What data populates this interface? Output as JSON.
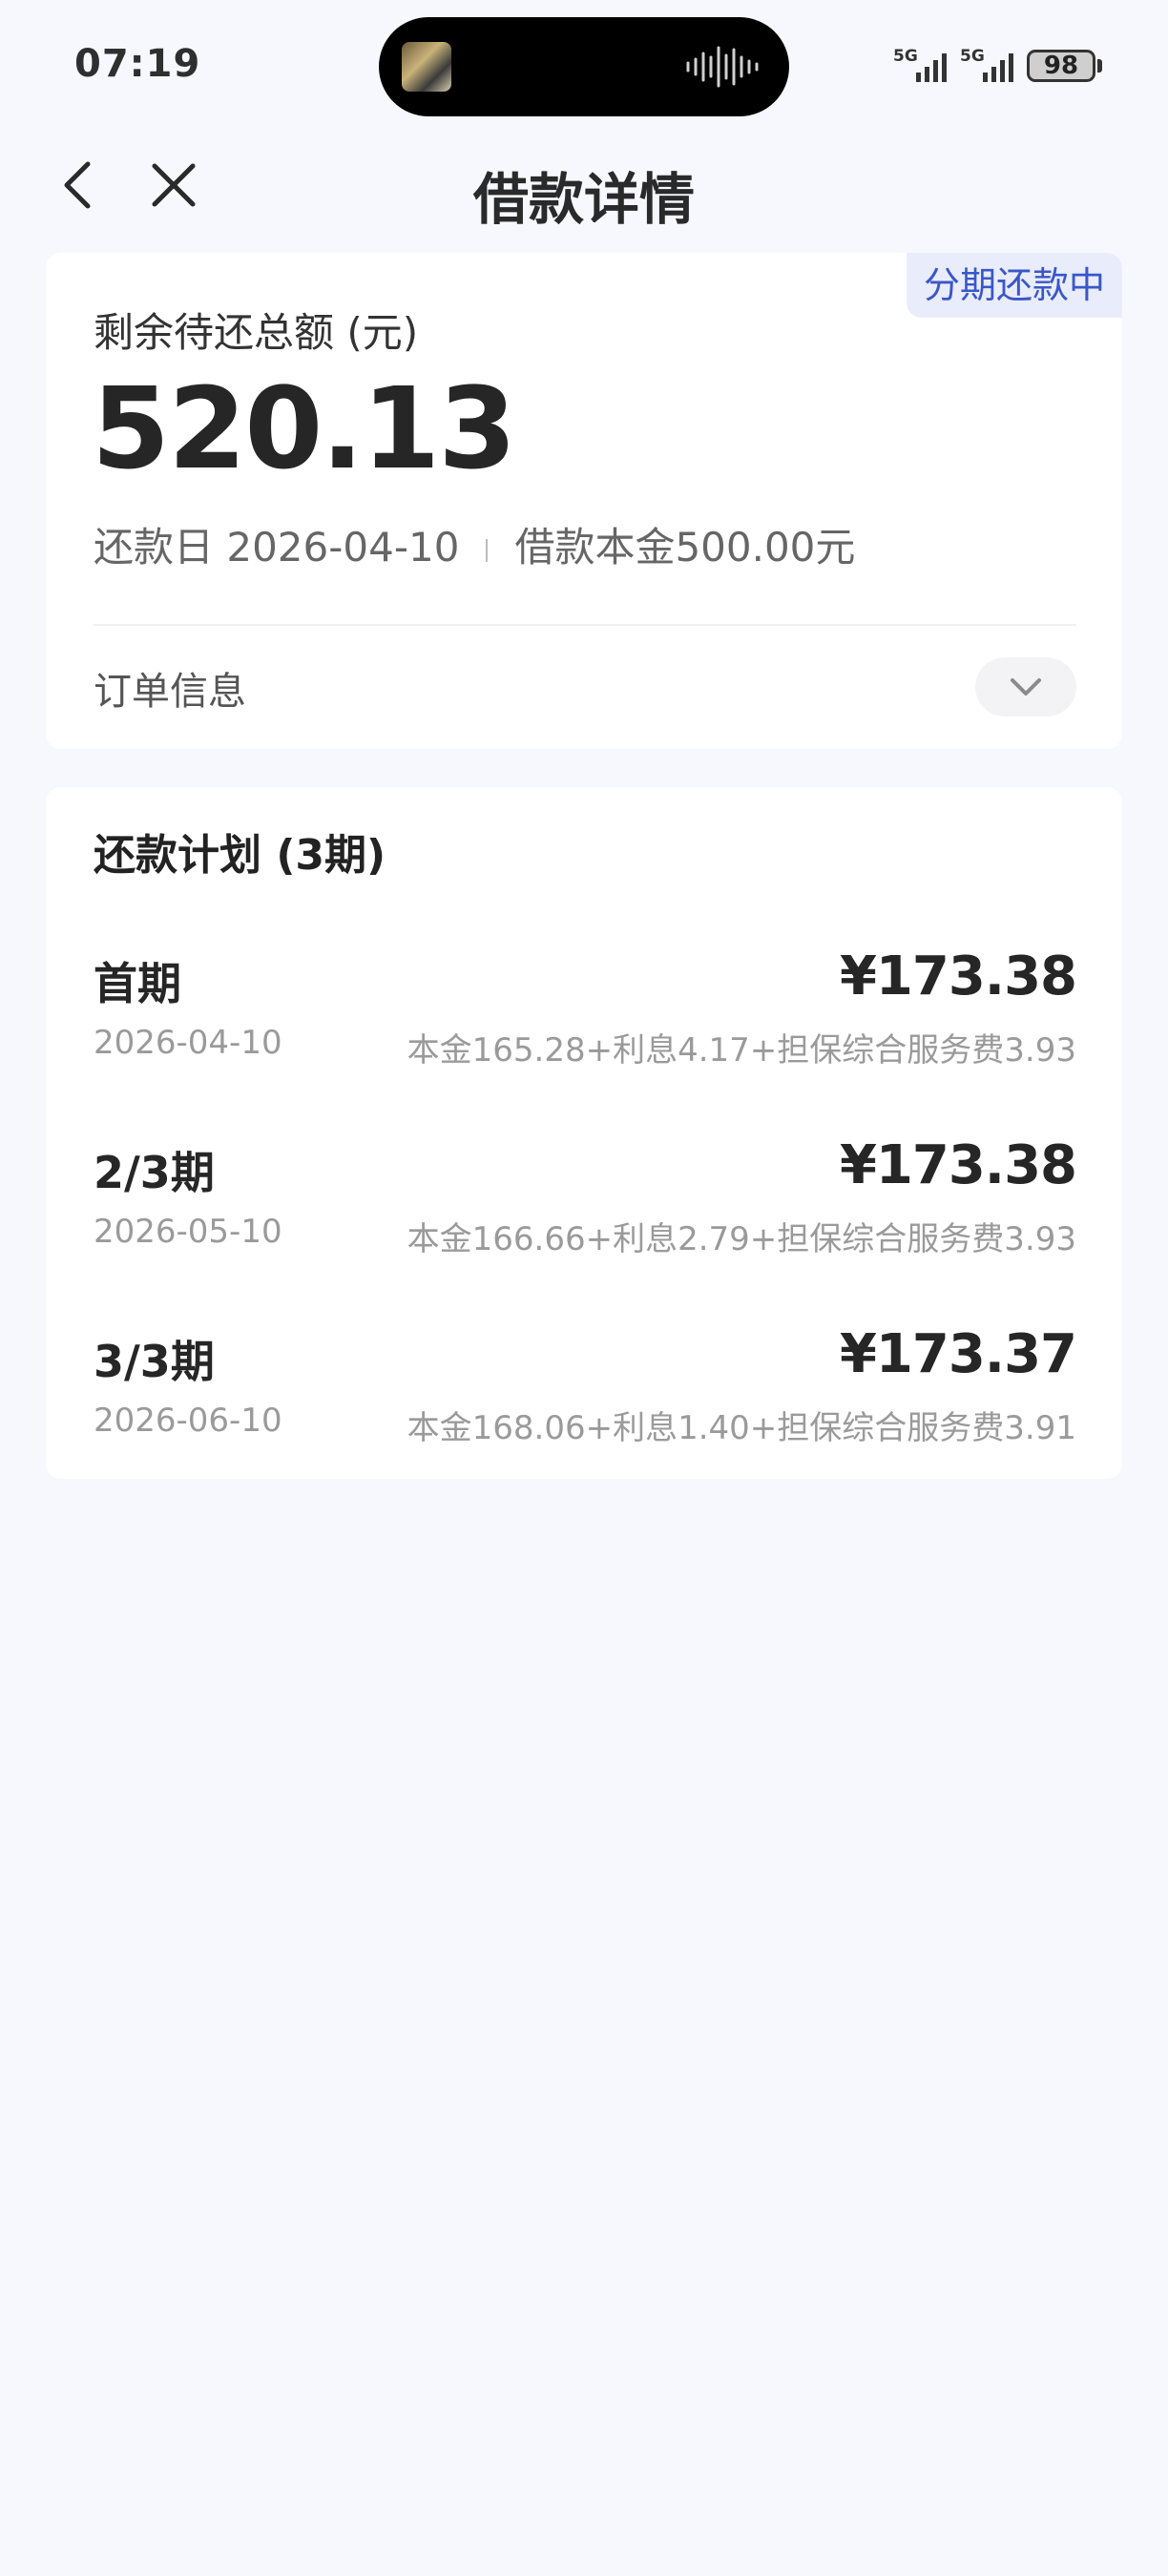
{
  "status_bar": {
    "time": "07:19",
    "network_1": "5G",
    "network_2": "5G",
    "battery": "98"
  },
  "nav": {
    "title": "借款详情"
  },
  "summary": {
    "status_badge": "分期还款中",
    "remaining_label": "剩余待还总额 (元)",
    "remaining_amount": "520.13",
    "due_date_text": "还款日 2026-04-10",
    "principal_text": "借款本金500.00元",
    "order_info_label": "订单信息"
  },
  "plan": {
    "title": "还款计划 (3期)",
    "installments": [
      {
        "label": "首期",
        "amount": "¥173.38",
        "date": "2026-04-10",
        "detail": "本金165.28+利息4.17+担保综合服务费3.93"
      },
      {
        "label": "2/3期",
        "amount": "¥173.38",
        "date": "2026-05-10",
        "detail": "本金166.66+利息2.79+担保综合服务费3.93"
      },
      {
        "label": "3/3期",
        "amount": "¥173.37",
        "date": "2026-06-10",
        "detail": "本金168.06+利息1.40+担保综合服务费3.91"
      }
    ]
  },
  "colors": {
    "background": "#f7f8fe",
    "card": "#ffffff",
    "badge_bg": "#e9edfb",
    "badge_text": "#3a57c9"
  }
}
